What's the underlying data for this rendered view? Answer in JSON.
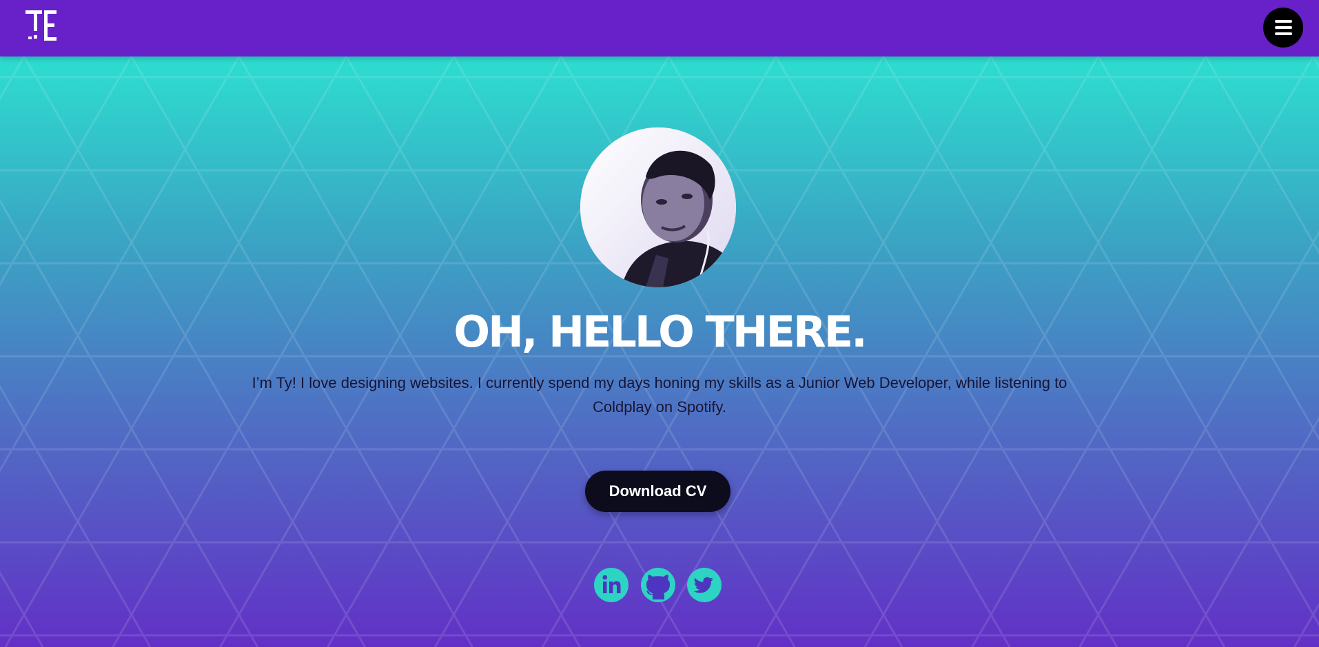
{
  "header": {
    "logo_icon": "te-monogram-logo",
    "menu_icon": "hamburger-menu-icon",
    "background_color": "#6820c9"
  },
  "hero": {
    "gradient_colors": [
      "#2dded0",
      "#3aa6c4",
      "#4e72c4",
      "#6230c6"
    ],
    "avatar_icon": "profile-photo",
    "headline": "OH, HELLO THERE.",
    "intro": "I’m Ty! I love designing websites. I currently spend my days honing my skills as a Junior Web Developer, while listening to Coldplay on Spotify.",
    "cv_button_label": "Download CV"
  },
  "social": {
    "accent_color": "#2dd3c3",
    "links": [
      {
        "icon": "linkedin-icon"
      },
      {
        "icon": "github-icon"
      },
      {
        "icon": "twitter-icon"
      }
    ]
  }
}
